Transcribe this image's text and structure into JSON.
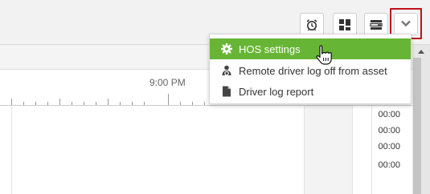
{
  "toolbar": {
    "alarm_icon": "alarm-clock-icon",
    "widgets_icon": "dashboard-grid-icon",
    "list_icon": "list-settings-icon",
    "expand_icon": "chevron-down-icon",
    "highlight_color": "#c0121c"
  },
  "timeline": {
    "time_label": "9:00 PM"
  },
  "menu": {
    "accent_color": "#67b535",
    "items": [
      {
        "label": "HOS settings",
        "icon": "gear-icon",
        "active": true
      },
      {
        "label": "Remote driver log off from asset",
        "icon": "driver-icon",
        "active": false
      },
      {
        "label": "Driver log report",
        "icon": "document-icon",
        "active": false
      }
    ]
  },
  "grid": {
    "times": [
      "00:00",
      "00:00",
      "00:00",
      "00:00"
    ]
  }
}
